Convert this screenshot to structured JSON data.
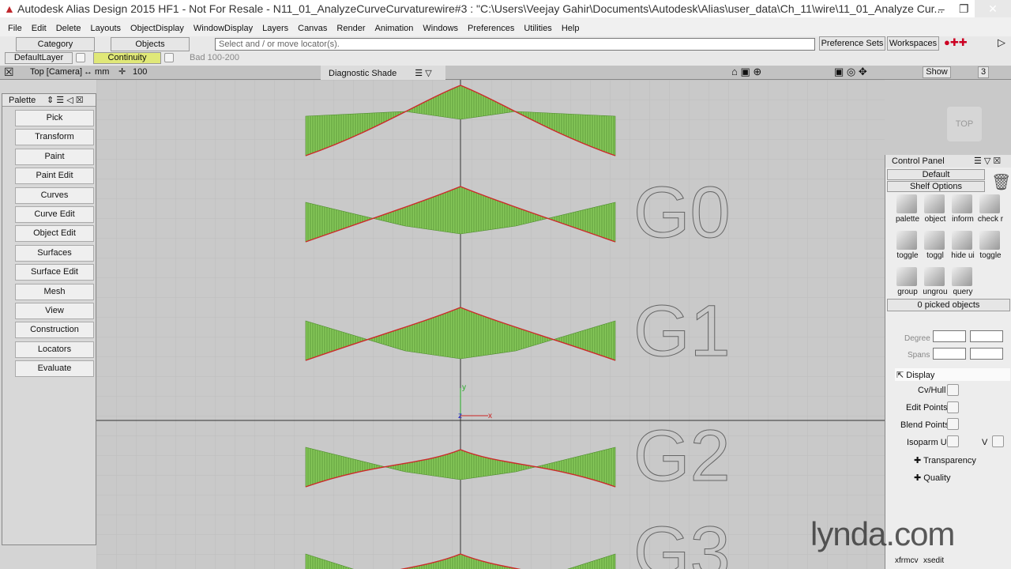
{
  "window": {
    "title": "Autodesk Alias Design 2015 HF1 - Not For Resale   - N11_01_AnalyzeCurveCurvaturewire#3 : \"C:\\Users\\Veejay Gahir\\Documents\\Autodesk\\Alias\\user_data\\Ch_11\\wire\\11_01_Analyze Cur..."
  },
  "menu": [
    "File",
    "Edit",
    "Delete",
    "Layouts",
    "ObjectDisplay",
    "WindowDisplay",
    "Layers",
    "Canvas",
    "Render",
    "Animation",
    "Windows",
    "Preferences",
    "Utilities",
    "Help"
  ],
  "toolbar": {
    "category": "Category",
    "objects": "Objects",
    "prompt": "Select and / or move locator(s).",
    "pref_sets": "Preference Sets",
    "workspaces": "Workspaces"
  },
  "layerbar": {
    "default_layer": "DefaultLayer",
    "continuity": "Continuity",
    "bad": "Bad 100-200"
  },
  "viewhdr": {
    "camera": "Top [Camera]",
    "units": "↔ mm",
    "grid": "100",
    "shade": "Diagnostic Shade",
    "show": "Show",
    "num": "3"
  },
  "palette": {
    "title": "Palette",
    "items": [
      "Pick",
      "Transform",
      "Paint",
      "Paint Edit",
      "Curves",
      "Curve Edit",
      "Object Edit",
      "Surfaces",
      "Surface Edit",
      "Mesh",
      "View",
      "Construction",
      "Locators",
      "Evaluate"
    ]
  },
  "viewport": {
    "labels": [
      "G0",
      "G1",
      "G2",
      "G3"
    ],
    "cube": "TOP",
    "axis_x": "x",
    "axis_y": "y",
    "axis_z": "z"
  },
  "control_panel": {
    "title": "Control Panel",
    "shelf": "Default",
    "shelf_options": "Shelf Options",
    "icons": [
      "palette",
      "object",
      "inform",
      "check r",
      "toggle",
      "toggl",
      "hide ui",
      "toggle",
      "group",
      "ungrou",
      "query"
    ],
    "picked": "0 picked objects",
    "degree": "Degree",
    "spans": "Spans",
    "display": "Display",
    "cv_hull": "Cv/Hull",
    "edit_points": "Edit Points",
    "blend_points": "Blend Points",
    "isoparm_u": "Isoparm U",
    "v": "V",
    "transparency": "Transparency",
    "quality": "Quality",
    "bottom_icons": [
      "xfrmcv",
      "xsedit"
    ]
  },
  "watermark": "lynda.com",
  "colors": {
    "curve": "#cc2a2a",
    "comb": "#6fb83a",
    "bg": "#c9c9c9"
  }
}
